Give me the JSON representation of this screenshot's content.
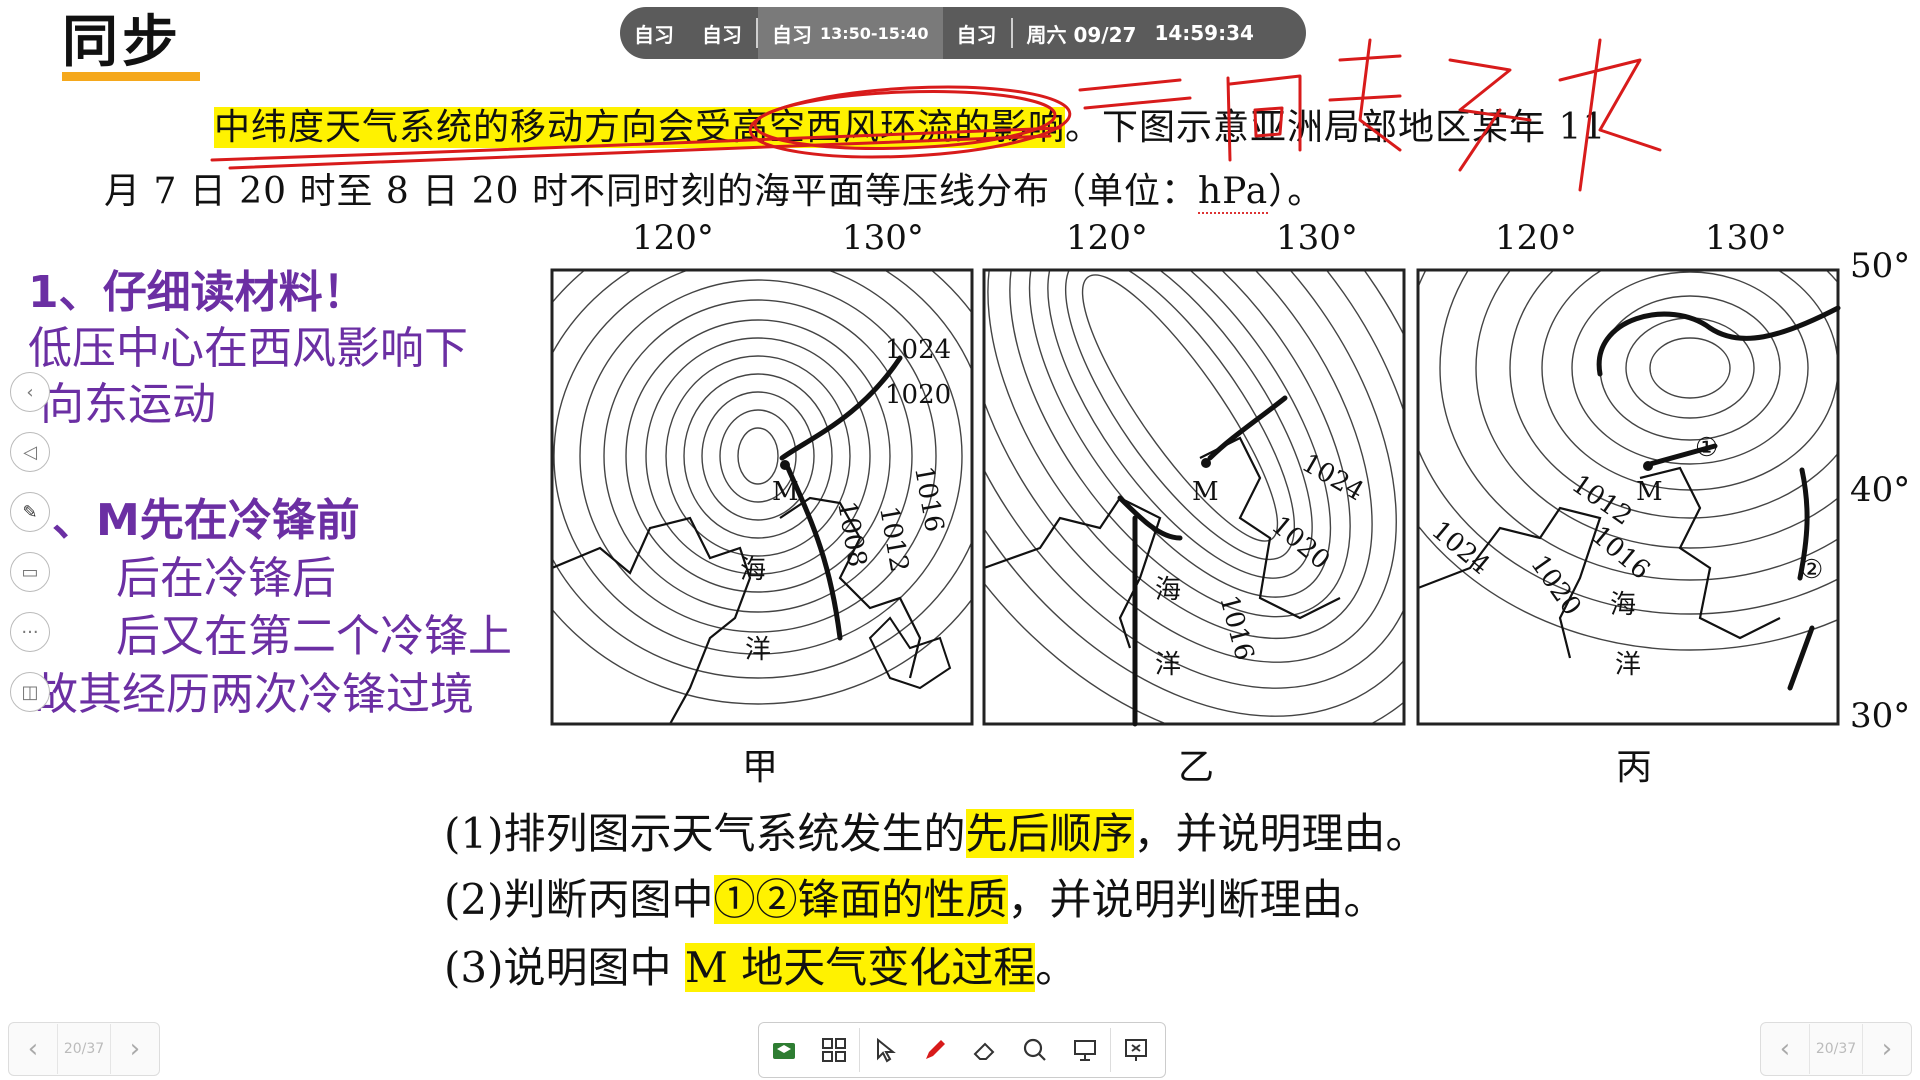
{
  "title": "同步",
  "schedule": {
    "items": [
      {
        "label": "自习"
      },
      {
        "label": "自习"
      },
      {
        "label": "自习",
        "time": "13:50-15:40"
      },
      {
        "label": "自习"
      }
    ],
    "date": "周六 09/27",
    "clock": "14:59:34"
  },
  "problem": {
    "seg1_hl": "中纬度天气系统的移动方向会受高空西风环流的影响",
    "seg1_rest": "。下图示意亚洲局部地区某年 11",
    "line2_a": "月 7 日 20 时至 8 日 20 时不同时刻的海平面等压线分布（单位：",
    "line2_unit": "hPa",
    "line2_b": "）。"
  },
  "handwriting_top": "向东移动",
  "figure": {
    "longitudes": [
      "120°",
      "130°",
      "120°",
      "130°",
      "120°",
      "130°"
    ],
    "latitudes": [
      "50°",
      "40°",
      "30°"
    ],
    "panels": [
      {
        "label": "甲",
        "isobars": [
          "1024",
          "1020",
          "1016",
          "1012",
          "1008"
        ],
        "place": "M",
        "sea": [
          "海",
          "洋"
        ]
      },
      {
        "label": "乙",
        "isobars": [
          "1024",
          "1020",
          "1016"
        ],
        "place": "M",
        "sea": [
          "海",
          "洋"
        ]
      },
      {
        "label": "丙",
        "isobars": [
          "1012",
          "1016",
          "1020",
          "1024"
        ],
        "place": "M",
        "sea": [
          "海",
          "洋"
        ],
        "fronts": [
          "①",
          "②"
        ]
      }
    ]
  },
  "notes": {
    "line1": "1、仔细读材料！",
    "line2": "低压中心在西风影响下",
    "line3": "向东运动",
    "line4": "、M先在冷锋前",
    "line5": "后在冷锋后",
    "line6": "后又在第二个冷锋上",
    "line7": "故其经历两次冷锋过境"
  },
  "questions": {
    "q1_a": "(1)排列图示天气系统发生的",
    "q1_hl": "先后顺序",
    "q1_b": "，并说明理由。",
    "q2_a": "(2)判断丙图中",
    "q2_hl": "①②锋面的性质",
    "q2_b": "，并说明判断理由。",
    "q3_a": "(3)说明图中 ",
    "q3_hl": "M 地天气变化过程",
    "q3_b": "。"
  },
  "side_tools": [
    "prev-icon",
    "back-icon",
    "pen-icon",
    "screen-icon",
    "more-icon",
    "projector-icon"
  ],
  "page_nav": {
    "left_page": "20/37",
    "right_page": "20/37"
  },
  "toolbar": [
    "whiteboard-icon",
    "grid-icon",
    "pointer-icon",
    "pen-icon",
    "eraser-icon",
    "search-icon",
    "display-icon",
    "projector-icon"
  ],
  "colors": {
    "highlight": "#fff200",
    "annotation_red": "#d81b1b",
    "annotation_purple": "#6b2fa3",
    "title_underline": "#f5a81c",
    "schedule_bar": "#5b5b5b"
  }
}
